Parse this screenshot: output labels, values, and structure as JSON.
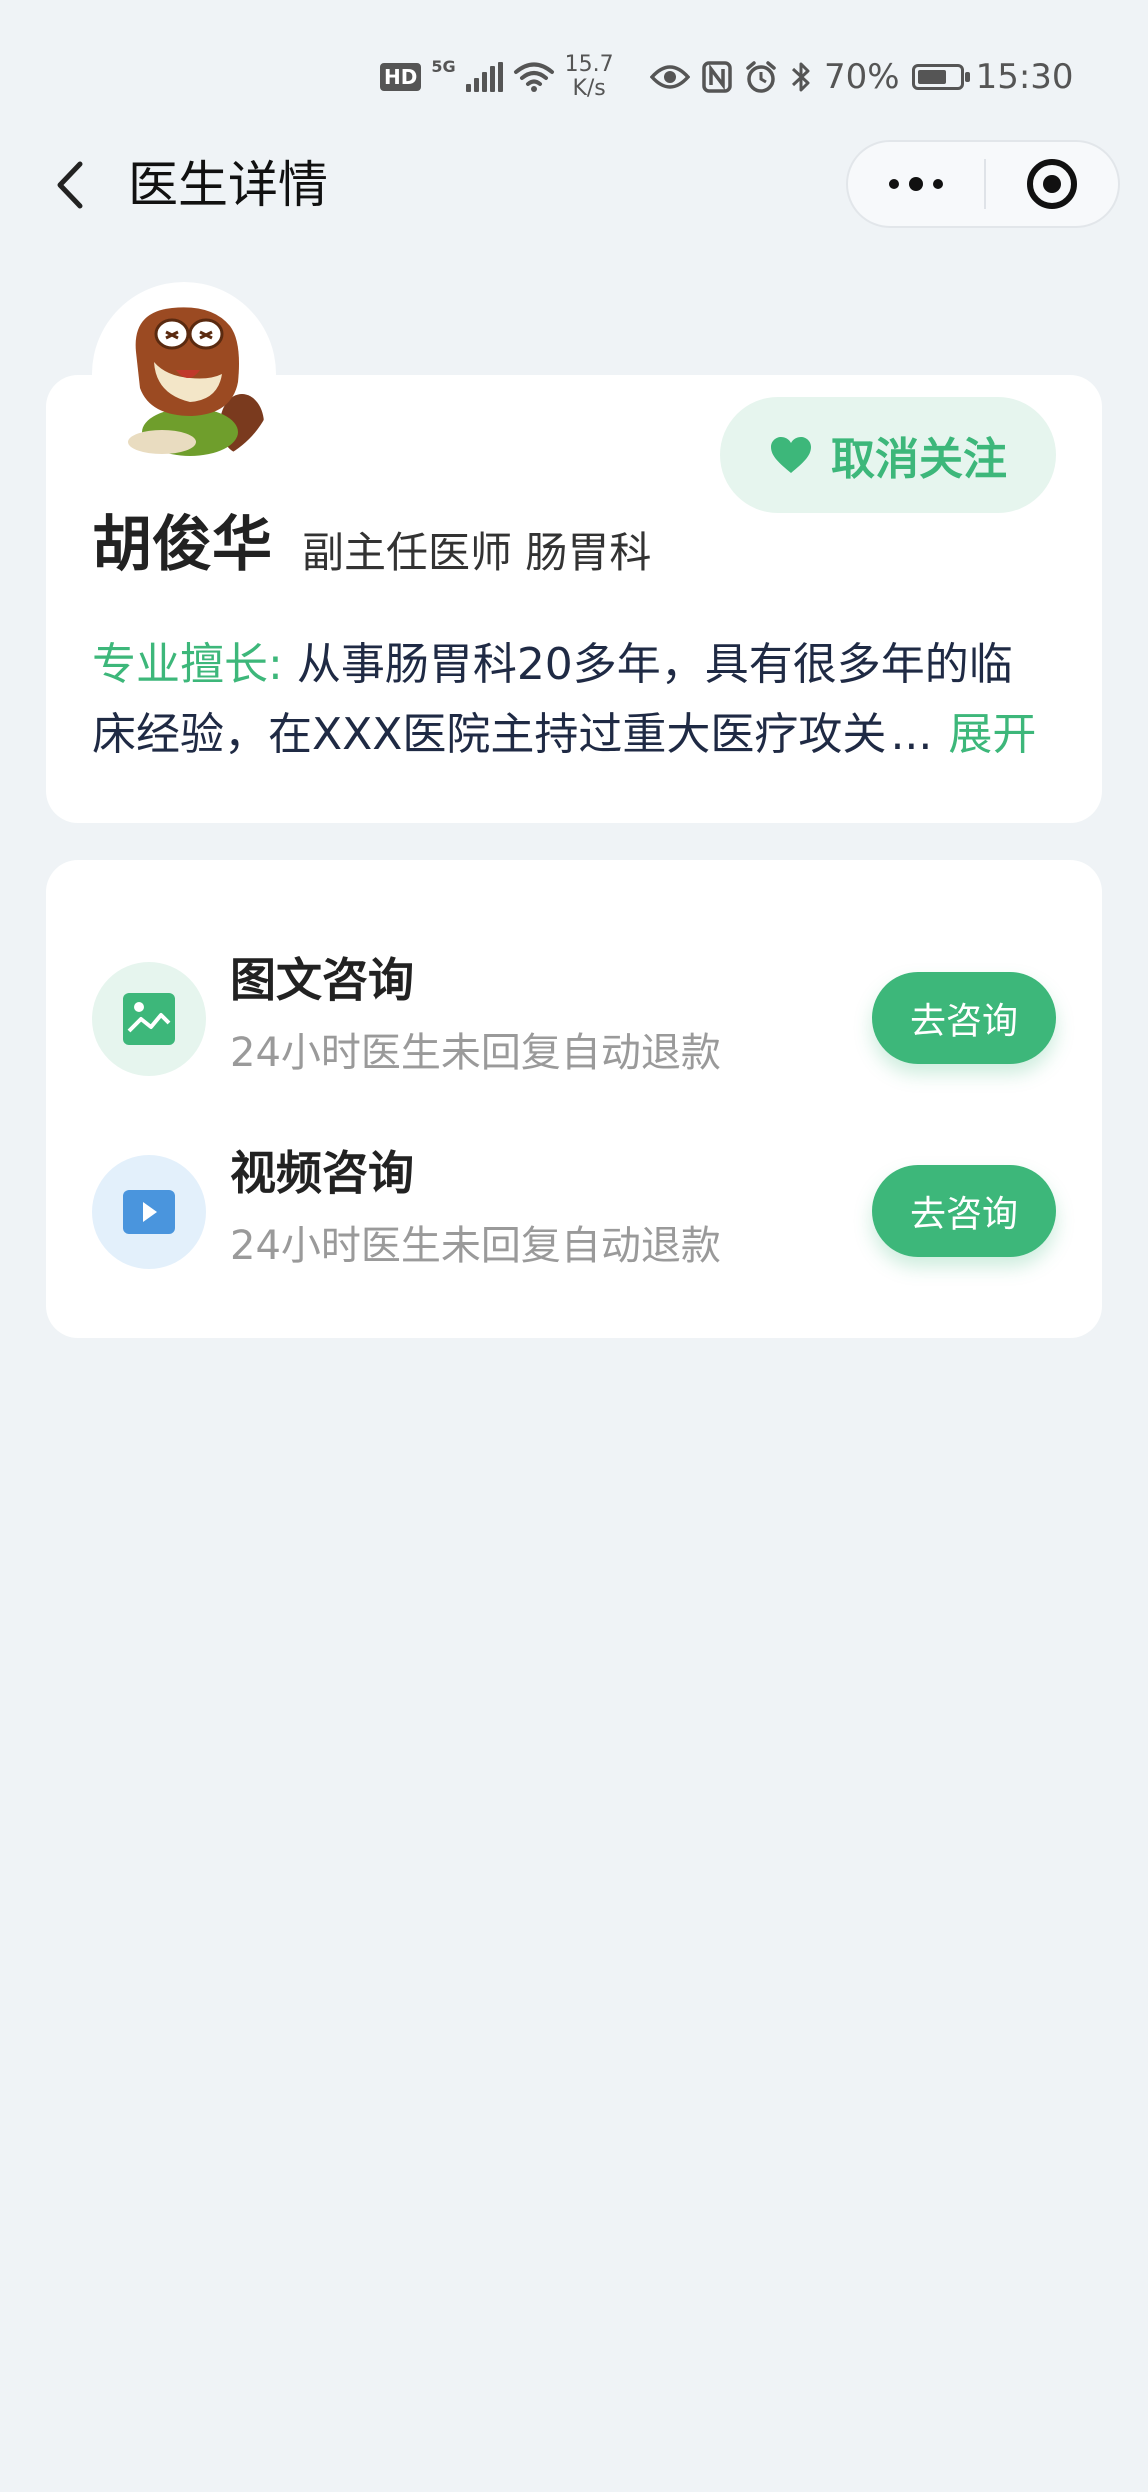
{
  "status_bar": {
    "hd": "HD",
    "network": "5G",
    "speed_value": "15.7",
    "speed_unit": "K/s",
    "battery_percent": "70%",
    "battery_level": 0.7,
    "time": "15:30"
  },
  "nav": {
    "title": "医生详情"
  },
  "doctor": {
    "name": "胡俊华",
    "title_dept": "副主任医师 肠胃科",
    "follow_label": "取消关注",
    "specialty_label": "专业擅长:",
    "specialty_line1": " 从事肠胃科20多年，具有很多年的临",
    "specialty_line2": "床经验，在XXX医院主持过重大医疗攻关",
    "ellipsis": "...",
    "expand_label": "展开"
  },
  "consultations": [
    {
      "title": "图文咨询",
      "desc": "24小时医生未回复自动退款",
      "button": "去咨询",
      "icon": "image-icon",
      "icon_bg": "#e6f5ee",
      "icon_color": "#3db77a"
    },
    {
      "title": "视频咨询",
      "desc": "24小时医生未回复自动退款",
      "button": "去咨询",
      "icon": "video-icon",
      "icon_bg": "#e3f0fb",
      "icon_color": "#4a95dd"
    }
  ],
  "colors": {
    "accent": "#3db77a",
    "background": "#eff3f6"
  }
}
